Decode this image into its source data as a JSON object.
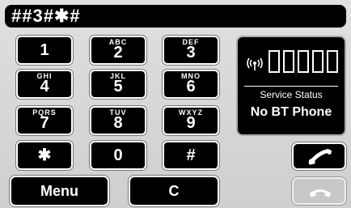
{
  "display": {
    "number": "##3#✱#"
  },
  "keypad": [
    {
      "id": "1",
      "main": "1",
      "sub": ""
    },
    {
      "id": "2",
      "main": "2",
      "sub": "ABC"
    },
    {
      "id": "3",
      "main": "3",
      "sub": "DEF"
    },
    {
      "id": "4",
      "main": "4",
      "sub": "GHI"
    },
    {
      "id": "5",
      "main": "5",
      "sub": "JKL"
    },
    {
      "id": "6",
      "main": "6",
      "sub": "MNO"
    },
    {
      "id": "7",
      "main": "7",
      "sub": "PQRS"
    },
    {
      "id": "8",
      "main": "8",
      "sub": "TUV"
    },
    {
      "id": "9",
      "main": "9",
      "sub": "WXYZ"
    },
    {
      "id": "star",
      "main": "✱",
      "sub": ""
    },
    {
      "id": "0",
      "main": "0",
      "sub": ""
    },
    {
      "id": "hash",
      "main": "#",
      "sub": ""
    }
  ],
  "status": {
    "signal_icon": "signal-icon",
    "signal_bars_filled": 0,
    "signal_bars_total": 5,
    "label": "Service Status",
    "value": "No BT Phone"
  },
  "buttons": {
    "menu": "Menu",
    "clear": "C",
    "call_icon": "phone-call-icon",
    "end_icon": "phone-hangup-icon"
  },
  "colors": {
    "key_bg": "#000000",
    "panel_bg": "#d6d6d6",
    "end_disabled": "#c8c8c8"
  }
}
